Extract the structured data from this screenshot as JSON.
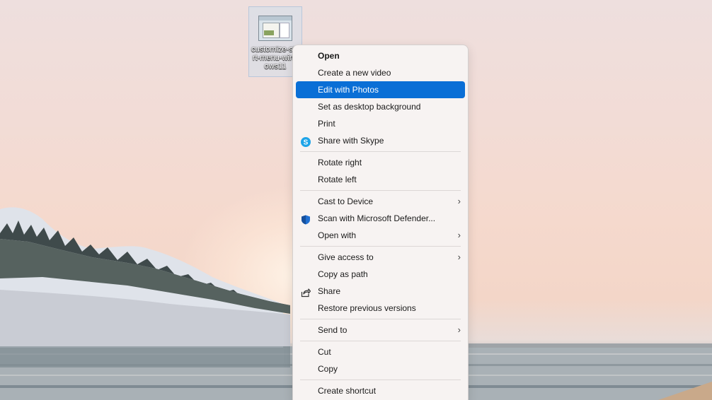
{
  "desktop_icon": {
    "label": "customize-start-menu-windows11"
  },
  "context_menu": {
    "groups": [
      [
        {
          "label": "Open",
          "bold": true
        },
        {
          "label": "Create a new video"
        },
        {
          "label": "Edit with Photos",
          "highlighted": true
        },
        {
          "label": "Set as desktop background"
        },
        {
          "label": "Print"
        },
        {
          "label": "Share with Skype",
          "icon": "skype-icon"
        }
      ],
      [
        {
          "label": "Rotate right"
        },
        {
          "label": "Rotate left"
        }
      ],
      [
        {
          "label": "Cast to Device",
          "submenu": true
        },
        {
          "label": "Scan with Microsoft Defender...",
          "icon": "defender-shield-icon"
        },
        {
          "label": "Open with",
          "submenu": true
        }
      ],
      [
        {
          "label": "Give access to",
          "submenu": true
        },
        {
          "label": "Copy as path"
        },
        {
          "label": "Share",
          "icon": "share-icon"
        },
        {
          "label": "Restore previous versions"
        }
      ],
      [
        {
          "label": "Send to",
          "submenu": true
        }
      ],
      [
        {
          "label": "Cut"
        },
        {
          "label": "Copy"
        }
      ],
      [
        {
          "label": "Create shortcut"
        }
      ]
    ]
  },
  "colors": {
    "highlight": "#0a6fd6",
    "skype": "#1ea4e8",
    "defender": "#1f6fd1"
  }
}
